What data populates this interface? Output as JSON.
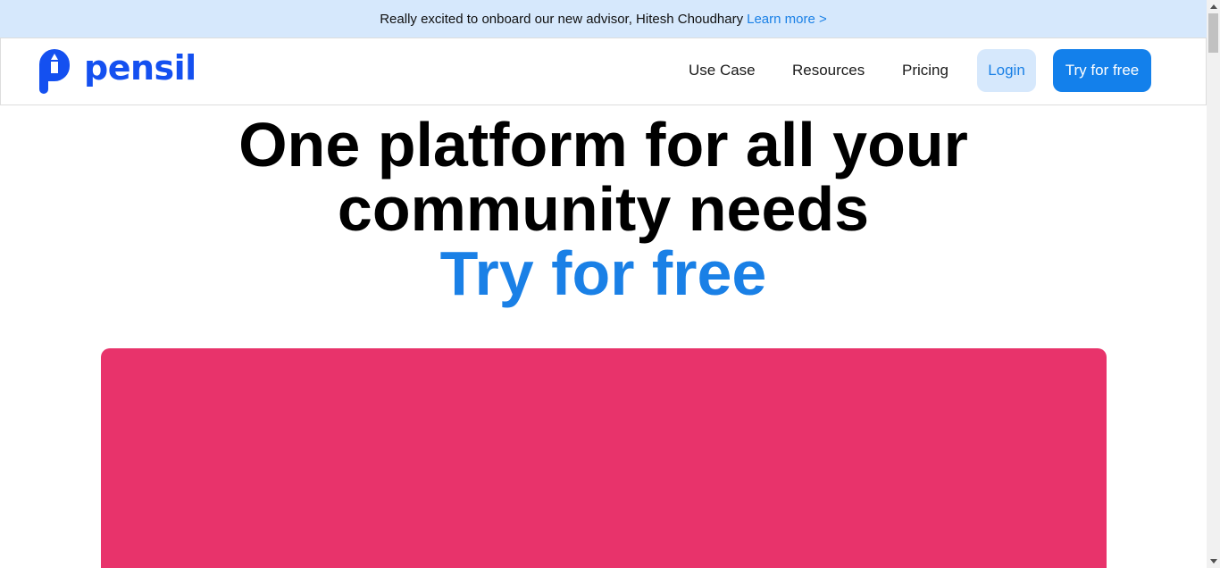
{
  "announcement": {
    "text": "Really excited to onboard our new advisor, Hitesh Choudhary",
    "link_label": "Learn more >"
  },
  "brand": {
    "name": "pensil",
    "color": "#1450f0"
  },
  "nav": {
    "items": [
      {
        "label": "Use Case"
      },
      {
        "label": "Resources"
      },
      {
        "label": "Pricing"
      }
    ],
    "login_label": "Login",
    "cta_label": "Try for free"
  },
  "hero": {
    "line1": "One platform for all your",
    "line2": "community needs",
    "cta": "Try for free"
  },
  "colors": {
    "accent": "#1380eb",
    "banner_bg": "#d6e8fc",
    "media_bg": "#e8336b"
  }
}
